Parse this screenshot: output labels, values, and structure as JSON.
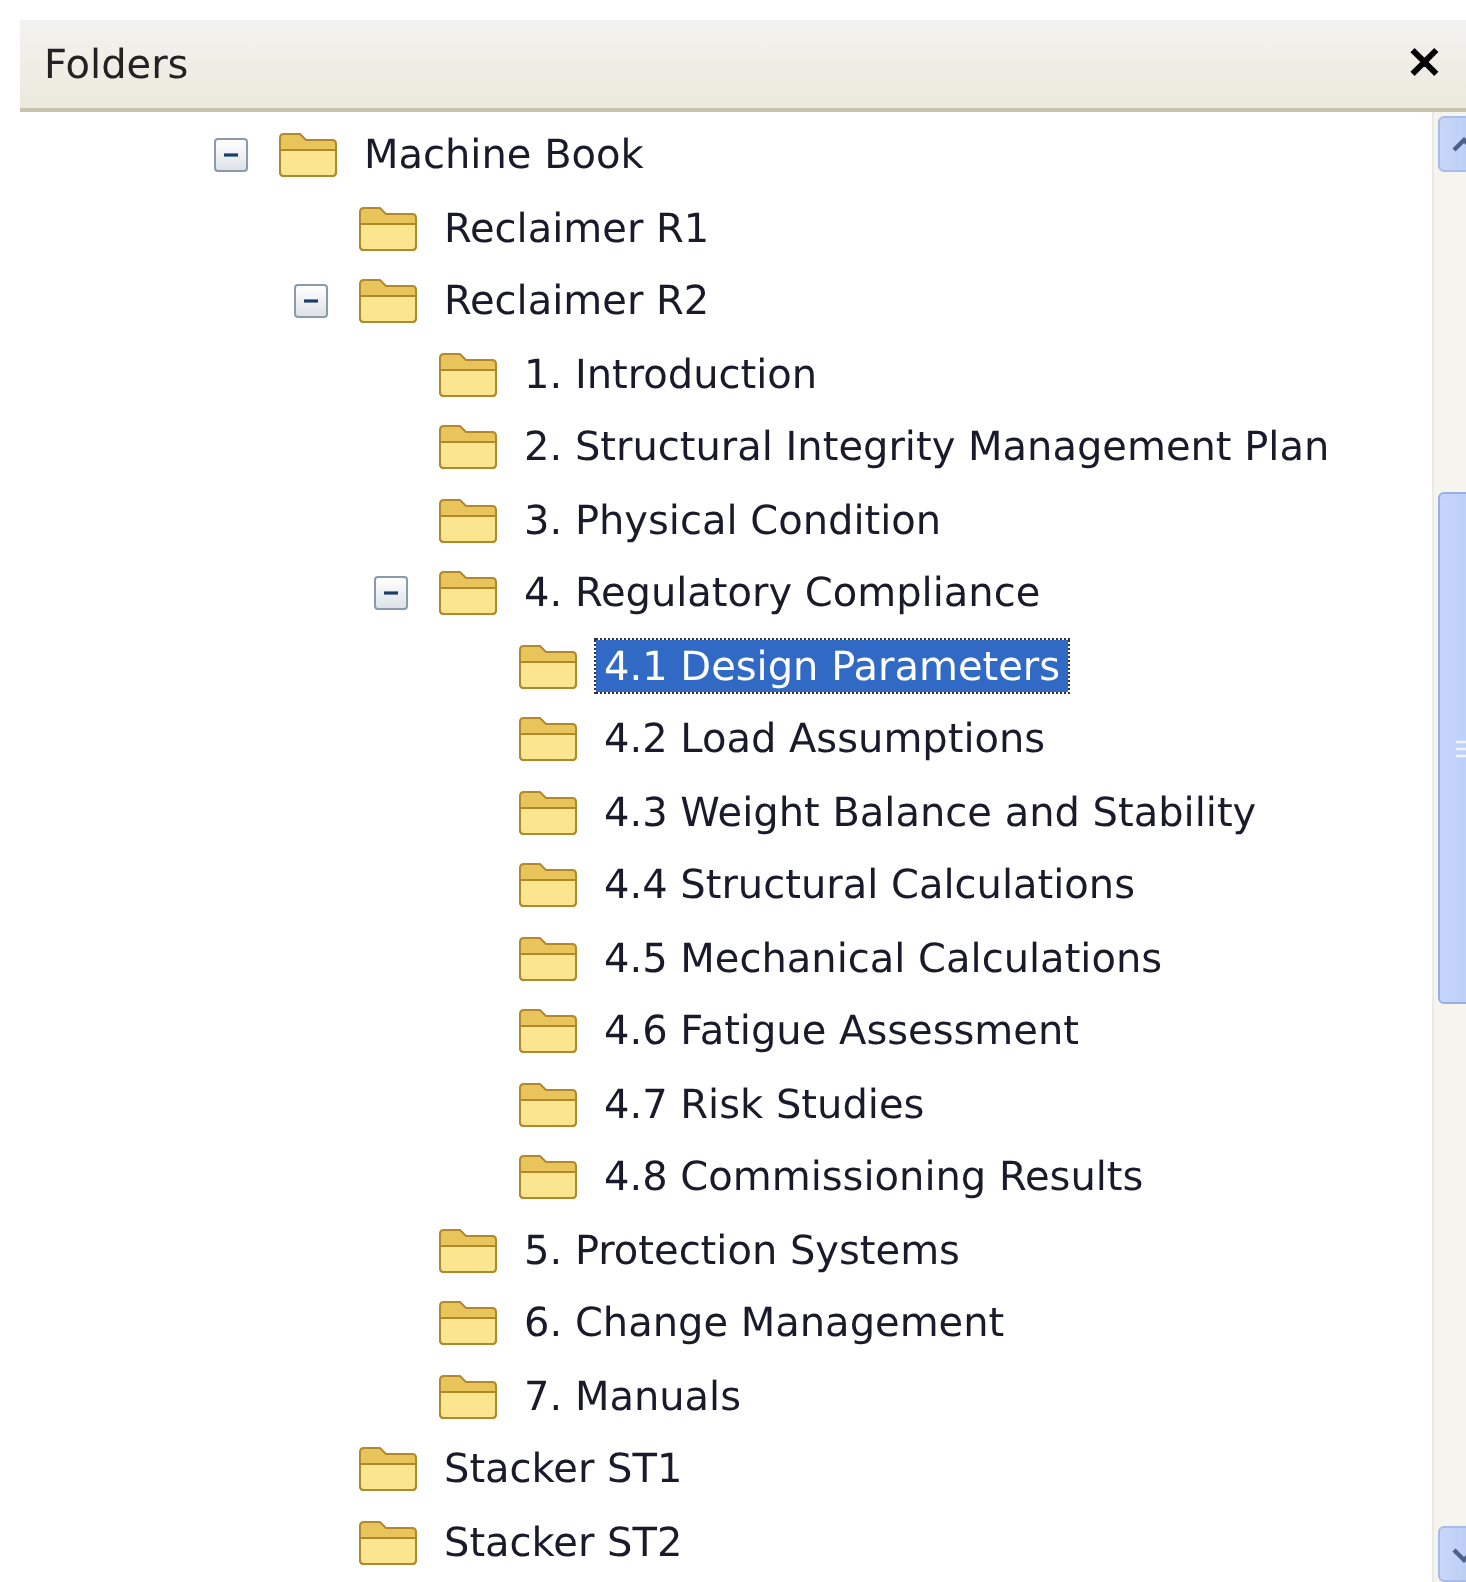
{
  "panel": {
    "title": "Folders",
    "close": "✕"
  },
  "tree": [
    {
      "label": "Machine Book",
      "expanded": true,
      "selected": false,
      "children": [
        {
          "label": "Reclaimer R1",
          "selected": false
        },
        {
          "label": "Reclaimer R2",
          "expanded": true,
          "selected": false,
          "children": [
            {
              "label": "1. Introduction",
              "selected": false
            },
            {
              "label": "2. Structural Integrity Management Plan",
              "selected": false
            },
            {
              "label": "3. Physical Condition",
              "selected": false
            },
            {
              "label": "4. Regulatory Compliance",
              "expanded": true,
              "selected": false,
              "children": [
                {
                  "label": "4.1 Design Parameters",
                  "selected": true
                },
                {
                  "label": "4.2 Load Assumptions",
                  "selected": false
                },
                {
                  "label": "4.3 Weight Balance and Stability",
                  "selected": false
                },
                {
                  "label": "4.4 Structural Calculations",
                  "selected": false
                },
                {
                  "label": "4.5 Mechanical Calculations",
                  "selected": false
                },
                {
                  "label": "4.6 Fatigue Assessment",
                  "selected": false
                },
                {
                  "label": "4.7 Risk Studies",
                  "selected": false
                },
                {
                  "label": "4.8 Commissioning Results",
                  "selected": false
                }
              ]
            },
            {
              "label": "5. Protection Systems",
              "selected": false
            },
            {
              "label": "6. Change Management",
              "selected": false
            },
            {
              "label": "7. Manuals",
              "selected": false
            }
          ]
        },
        {
          "label": "Stacker ST1",
          "selected": false
        },
        {
          "label": "Stacker ST2",
          "selected": false
        }
      ]
    }
  ]
}
